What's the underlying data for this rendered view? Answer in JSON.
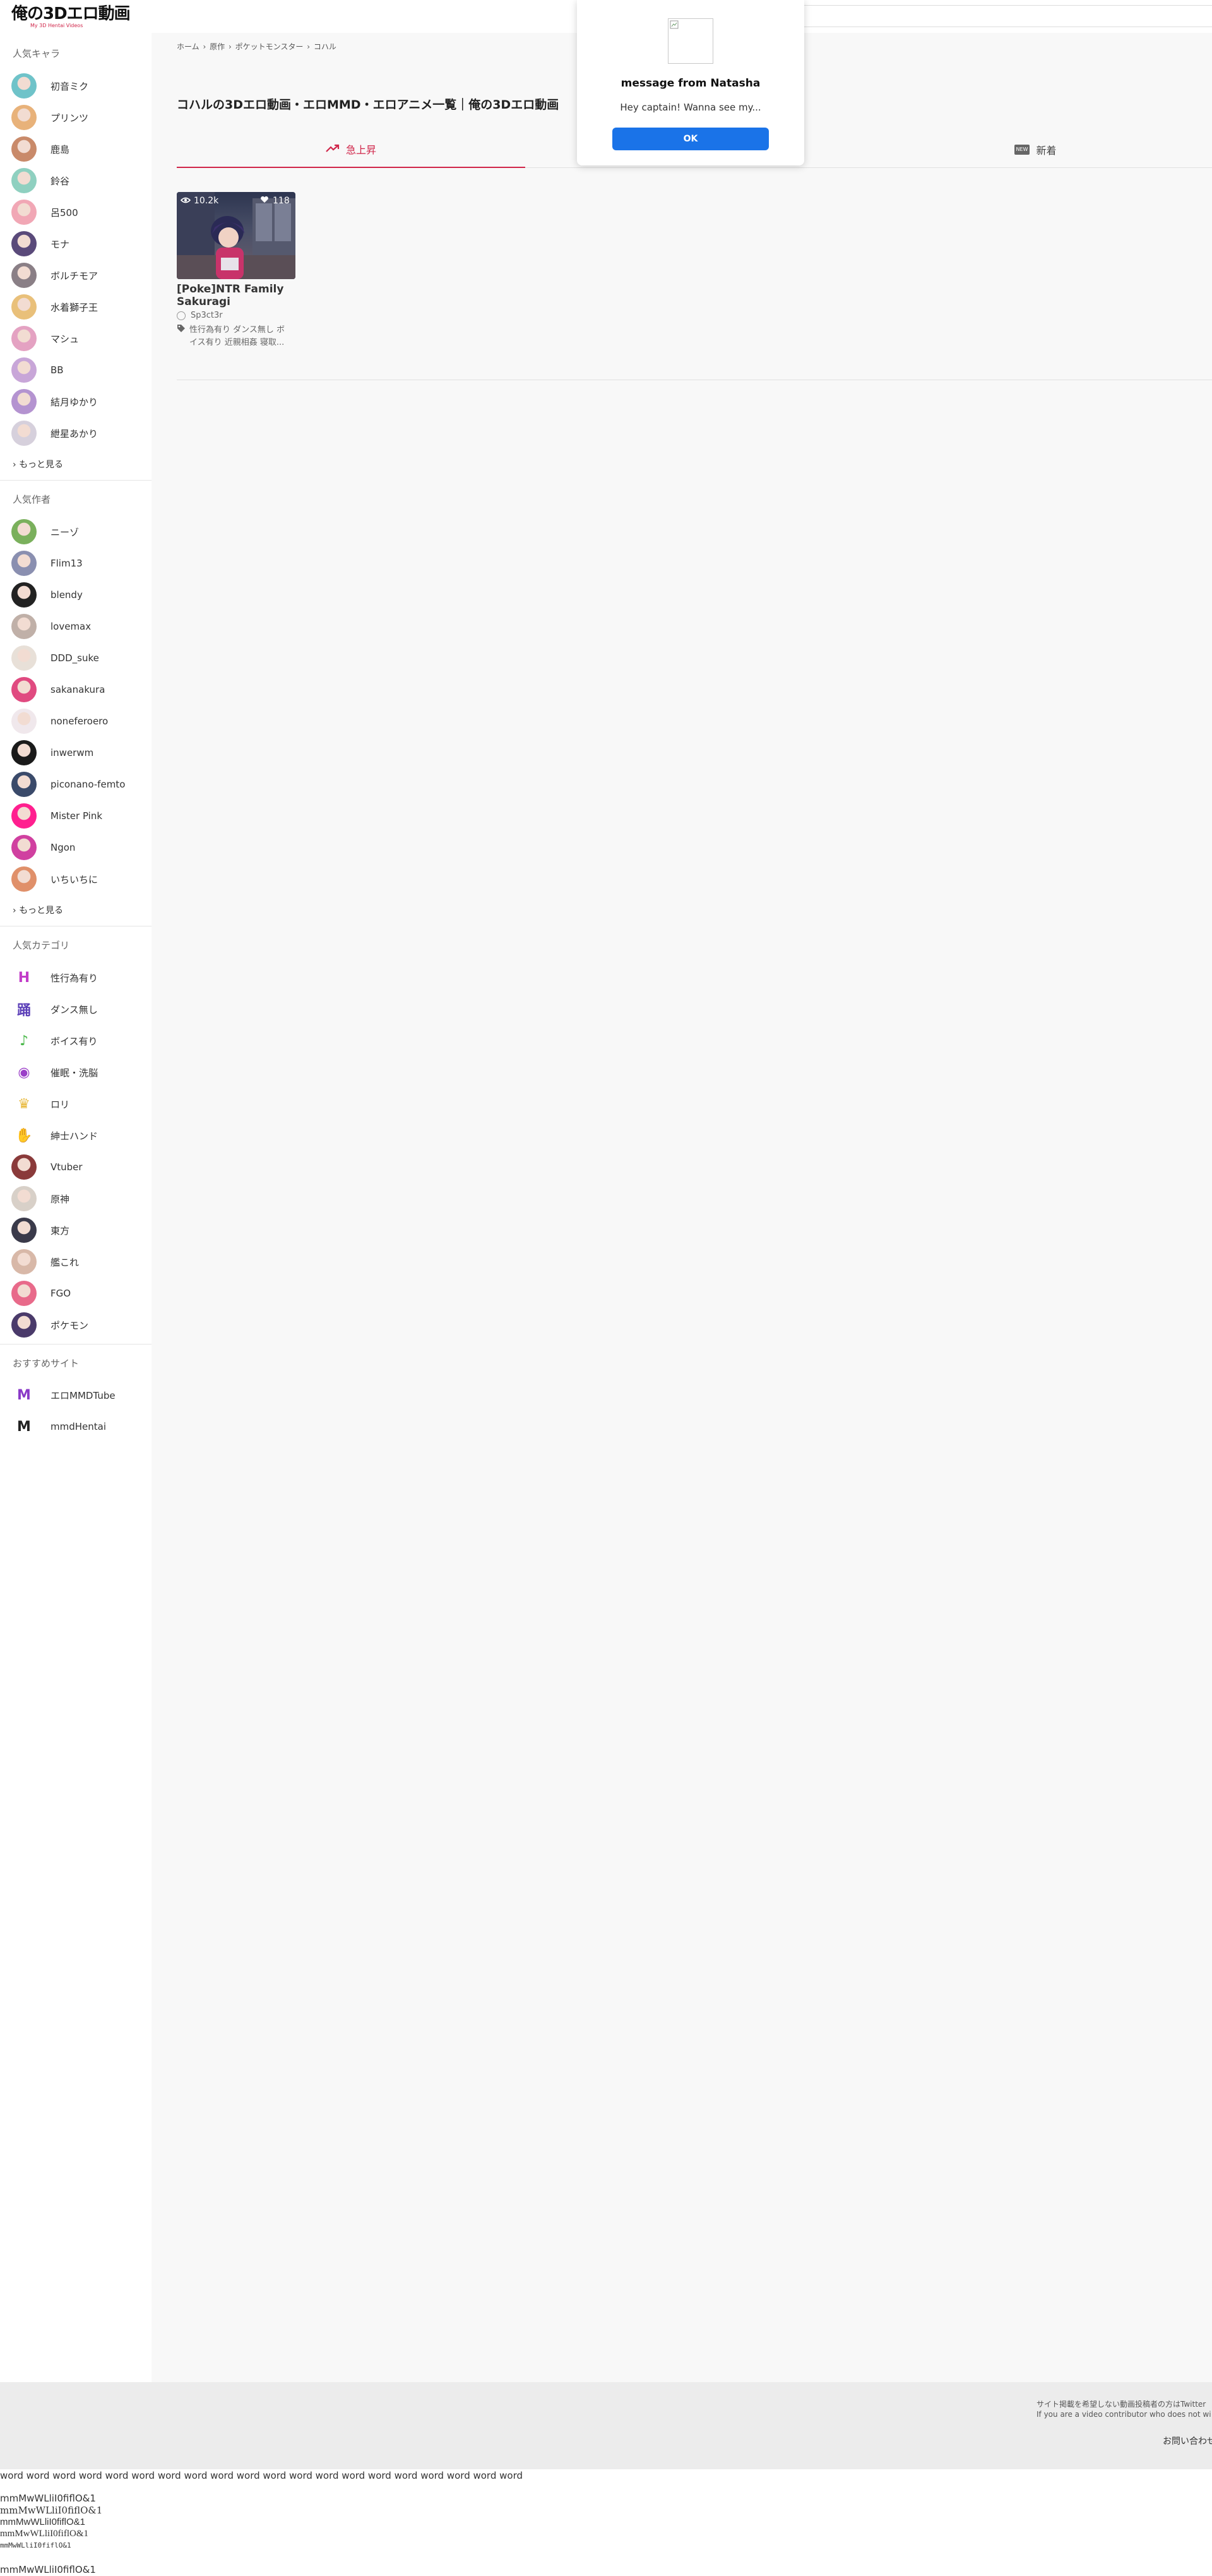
{
  "header": {
    "logo": "俺の3Dエロ動画",
    "logo_sub": "My 3D Hentai Videos"
  },
  "sidebar": {
    "popular_characters": {
      "title": "人気キャラ",
      "items": [
        {
          "label": "初音ミク",
          "color": "#6fc3c9"
        },
        {
          "label": "プリンツ",
          "color": "#e8b27a"
        },
        {
          "label": "鹿島",
          "color": "#c98a6a"
        },
        {
          "label": "鈴谷",
          "color": "#8fd0c0"
        },
        {
          "label": "呂500",
          "color": "#f1a7b5"
        },
        {
          "label": "モナ",
          "color": "#5a4a7a"
        },
        {
          "label": "ボルチモア",
          "color": "#8a7f86"
        },
        {
          "label": "水着獅子王",
          "color": "#e9c07a"
        },
        {
          "label": "マシュ",
          "color": "#e4a2c2"
        },
        {
          "label": "BB",
          "color": "#c8a6d8"
        },
        {
          "label": "結月ゆかり",
          "color": "#b493d0"
        },
        {
          "label": "紲星あかり",
          "color": "#d6d0dc"
        }
      ],
      "more": "もっと見る"
    },
    "popular_authors": {
      "title": "人気作者",
      "items": [
        {
          "label": "ニーゾ",
          "color": "#7ab05c"
        },
        {
          "label": "Flim13",
          "color": "#8a8fb0"
        },
        {
          "label": "blendy",
          "color": "#222222"
        },
        {
          "label": "lovemax",
          "color": "#c0b0a8"
        },
        {
          "label": "DDD_suke",
          "color": "#e8e0d8"
        },
        {
          "label": "sakanakura",
          "color": "#e04a80"
        },
        {
          "label": "noneferoero",
          "color": "#f0e8ec"
        },
        {
          "label": "inwerwm",
          "color": "#1a1a1a"
        },
        {
          "label": "piconano-femto",
          "color": "#3a4a6a"
        },
        {
          "label": "Mister Pink",
          "color": "#ff1f8f"
        },
        {
          "label": "Ngon",
          "color": "#d040a0"
        },
        {
          "label": "いちいちに",
          "color": "#e0906a"
        }
      ],
      "more": "もっと見る"
    },
    "popular_categories": {
      "title": "人気カテゴリ",
      "items": [
        {
          "label": "性行為有り",
          "icon": "H",
          "color": "#c23cc8"
        },
        {
          "label": "ダンス無し",
          "icon": "踊",
          "color": "#5b3fb8"
        },
        {
          "label": "ボイス有り",
          "icon": "♪",
          "color": "#4ab84a"
        },
        {
          "label": "催眠・洗脳",
          "icon": "◉",
          "color": "#9b3fc8"
        },
        {
          "label": "ロリ",
          "icon": "♛",
          "color": "#e8b83a"
        },
        {
          "label": "紳士ハンド",
          "icon": "✋",
          "color": "#3ac8b0"
        },
        {
          "label": "Vtuber",
          "icon": "",
          "color": "#8a3a3a"
        },
        {
          "label": "原神",
          "icon": "",
          "color": "#d8d0c8"
        },
        {
          "label": "東方",
          "icon": "",
          "color": "#3a3a4a"
        },
        {
          "label": "艦これ",
          "icon": "",
          "color": "#d8b8a8"
        },
        {
          "label": "FGO",
          "icon": "",
          "color": "#e86a8a"
        },
        {
          "label": "ポケモン",
          "icon": "",
          "color": "#4a3a6a"
        }
      ]
    },
    "recommended_sites": {
      "title": "おすすめサイト",
      "items": [
        {
          "label": "エロMMDTube",
          "icon": "M",
          "color": "#8a3ac8"
        },
        {
          "label": "mmdHentai",
          "icon": "M",
          "color": "#222222"
        }
      ]
    }
  },
  "breadcrumb": [
    "ホーム",
    "›",
    "原作",
    "›",
    "ポケットモンスター",
    "›",
    "コハル"
  ],
  "page_title": "コハルの3Dエロ動画・エロMMD・エロアニメ一覧｜俺の3Dエロ動画",
  "tabs": [
    {
      "label": "急上昇",
      "icon": "trending-up-icon"
    },
    {
      "label": "新着",
      "icon": "new-badge-icon",
      "badge": "NEW"
    }
  ],
  "video": {
    "views": "10.2k",
    "likes": "118",
    "title": "[Poke]NTR Family Sakuragi",
    "author": "Sp3ct3r",
    "tags": "性行為有り ダンス無し ボイス有り 近親相姦 寝取..."
  },
  "modal": {
    "title": "message from Natasha",
    "text": "Hey captain! Wanna see my...",
    "ok_label": "OK"
  },
  "footer": {
    "note_line1": "サイト掲載を希望しない動画投稿者の方はTwitter",
    "note_line2": "If you are a video contributor who does not wi",
    "contact": "お問い合わせ"
  },
  "probe": {
    "words": "word word word word word word word word word word word word word word word word word word word word",
    "line1": "mmMwWLliI0fiflO&1",
    "line2": "mmMwWLliI0fiflO&1",
    "line3": "mmMwWLliI0fiflO&1",
    "line4": "mmMwWLliI0fiflO&1",
    "line5": "mmMwWLliI0fiflO&1",
    "line6": "mmMwWLliI0fiflO&1"
  }
}
